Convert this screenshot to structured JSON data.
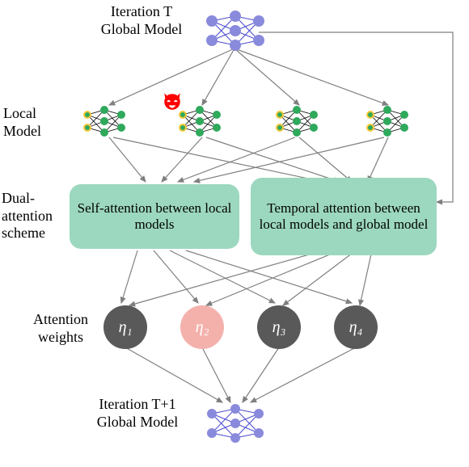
{
  "labels": {
    "iterT_line1": "Iteration T",
    "iterT_line2": "Global Model",
    "local_model": "Local\nModel",
    "dual_scheme": "Dual-\nattention\nscheme",
    "att_self": "Self-attention between local models",
    "att_temporal": "Temporal attention between local models and global model",
    "att_weights": "Attention\nweights",
    "iterT1_line1": "Iteration T+1",
    "iterT1_line2": "Global Model"
  },
  "weights": {
    "w1": "η₁",
    "w2": "η₂",
    "w3": "η₃",
    "w4": "η₄"
  },
  "colors": {
    "global_node": "#8a8adc",
    "local_outer": "#f8c93a",
    "local_inner": "#2fa95b",
    "box": "#9cd8bf",
    "arrow": "#7f7f7f",
    "pink": "#f4b1ac",
    "grey": "#595959"
  }
}
